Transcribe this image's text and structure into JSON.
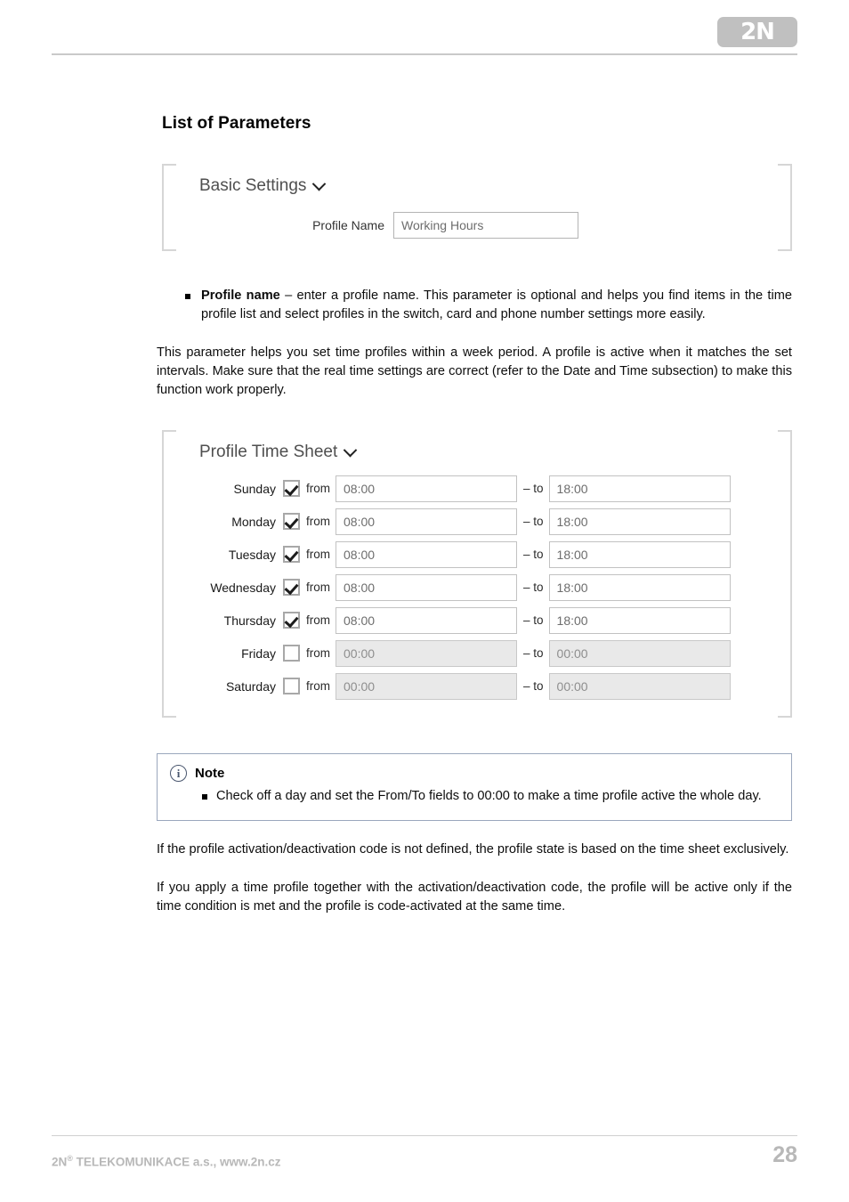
{
  "header": {
    "logo_text": "2N"
  },
  "page_title": "List of Parameters",
  "basic_settings": {
    "title": "Basic Settings",
    "chevron": "chevron-down-icon",
    "profile_name_label": "Profile Name",
    "profile_name_value": "Working Hours"
  },
  "bullets": [
    {
      "term": "Profile name",
      "text": " – enter a profile name. This parameter is optional and helps you find items in the time profile list and select profiles in the switch, card and phone number settings more easily."
    }
  ],
  "intro_paragraph": "This parameter helps you set time profiles within a week period. A profile is active when it matches the set intervals. Make sure that the real time settings are correct (refer to the Date and Time subsection) to make this function work properly.",
  "time_sheet": {
    "title": "Profile Time Sheet",
    "chevron": "chevron-down-icon",
    "from_label": "from",
    "to_label": "– to",
    "rows": [
      {
        "day": "Sunday",
        "checked": true,
        "from": "08:00",
        "to": "18:00"
      },
      {
        "day": "Monday",
        "checked": true,
        "from": "08:00",
        "to": "18:00"
      },
      {
        "day": "Tuesday",
        "checked": true,
        "from": "08:00",
        "to": "18:00"
      },
      {
        "day": "Wednesday",
        "checked": true,
        "from": "08:00",
        "to": "18:00"
      },
      {
        "day": "Thursday",
        "checked": true,
        "from": "08:00",
        "to": "18:00"
      },
      {
        "day": "Friday",
        "checked": false,
        "from": "00:00",
        "to": "00:00"
      },
      {
        "day": "Saturday",
        "checked": false,
        "from": "00:00",
        "to": "00:00"
      }
    ]
  },
  "note": {
    "icon": "info-circle-icon",
    "title": "Note",
    "items": [
      "Check off a day and set the From/To fields to 00:00 to make a time profile active the whole day."
    ]
  },
  "closing_paragraphs": [
    "If the profile activation/deactivation code is not defined, the profile state is based on the time sheet exclusively.",
    "If you apply a time profile together with the activation/deactivation code, the profile will be active only if the time condition is met and the profile is code-activated at the same time."
  ],
  "footer": {
    "company": "TELEKOMUNIKACE a.s., www.2n.cz",
    "brand": "2N",
    "registered": "®",
    "page_number": "28"
  },
  "colors": {
    "rule": "#c9c9c9",
    "panel_bracket": "#d6d6d6",
    "note_border": "#9aa7bd",
    "footer_text": "#b8b8b8",
    "input_text": "#6d6d6d",
    "disabled_bg": "#e9e9e9"
  }
}
